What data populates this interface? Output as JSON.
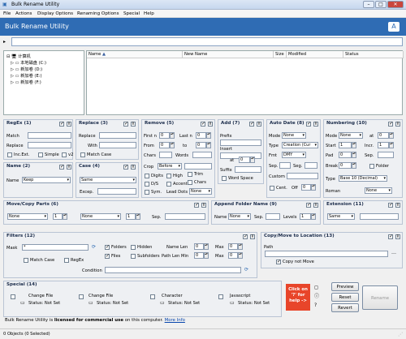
{
  "window": {
    "title": "Bulk Rename Utility",
    "minimize": "–",
    "maximize": "□",
    "close": "✕"
  },
  "menu": [
    "File",
    "Actions",
    "Display Options",
    "Renaming Options",
    "Special",
    "Help"
  ],
  "header": {
    "title": "Bulk Rename Utility"
  },
  "tree": {
    "root": "计算机",
    "items": [
      "本地磁盘 (C:)",
      "新加卷 (D:)",
      "新加卷 (E:)",
      "新加卷 (F:)"
    ]
  },
  "filelist": {
    "columns": [
      "Name",
      "New Name",
      "Size",
      "Modified",
      "Status"
    ]
  },
  "regex": {
    "title": "RegEx (1)",
    "match": "Match",
    "replace": "Replace",
    "incext": "Inc.Ext.",
    "simple": "Simple",
    "v2": "v2"
  },
  "replace": {
    "title": "Replace (3)",
    "replace": "Replace",
    "with": "With",
    "matchcase": "Match Case"
  },
  "remove": {
    "title": "Remove (5)",
    "firstn": "First n",
    "lastn": "Last n",
    "from": "From",
    "to": "to",
    "chars": "Chars",
    "words": "Words",
    "crop": "Crop",
    "crop_val": "Before",
    "digits": "Digits",
    "high": "High",
    "trim": "Trim",
    "ds": "D/S",
    "accents": "Accents",
    "chars2": "Chars",
    "sym": "Sym.",
    "leaddots": "Lead Dots",
    "leaddots_val": "None",
    "firstn_val": "0",
    "lastn_val": "0",
    "from_val": "0",
    "to_val": "0"
  },
  "add": {
    "title": "Add (7)",
    "prefix": "Prefix",
    "insert": "Insert",
    "at": "at",
    "at_val": "0",
    "suffix": "Suffix",
    "wordspace": "Word Space"
  },
  "autodate": {
    "title": "Auto Date (8)",
    "mode": "Mode",
    "mode_val": "None",
    "type": "Type",
    "type_val": "Creation (Cur",
    "fmt": "Fmt",
    "fmt_val": "DMY",
    "sep": "Sep.",
    "seg": "Seg.",
    "custom": "Custom",
    "cent": "Cent.",
    "off": "Off",
    "off_val": "0"
  },
  "numbering": {
    "title": "Numbering (10)",
    "mode": "Mode",
    "mode_val": "None",
    "at": "at",
    "at_val": "0",
    "start": "Start",
    "start_val": "1",
    "incr": "Incr.",
    "incr_val": "1",
    "pad": "Pad",
    "pad_val": "0",
    "sep": "Sep.",
    "break": "Break",
    "break_val": "0",
    "folder": "Folder",
    "type": "Type",
    "type_val": "Base 10 (Decimal)",
    "roman": "Roman",
    "roman_val": "None"
  },
  "name": {
    "title": "Name (2)",
    "name": "Name",
    "name_val": "Keep"
  },
  "case": {
    "title": "Case (4)",
    "case_val": "Same",
    "excep": "Excep."
  },
  "movecopy": {
    "title": "Move/Copy Parts (6)",
    "sel1": "None",
    "num1": "1",
    "sel2": "None",
    "num2": "1",
    "sep": "Sep."
  },
  "appendfolder": {
    "title": "Append Folder Name (9)",
    "name": "Name",
    "name_val": "None",
    "sep": "Sep.",
    "levels": "Levels",
    "levels_val": "1"
  },
  "extension": {
    "title": "Extension (11)",
    "ext_val": "Same"
  },
  "filters": {
    "title": "Filters (12)",
    "mask": "Mask",
    "mask_val": "*",
    "folders": "Folders",
    "hidden": "Hidden",
    "files": "Files",
    "subfolders": "Subfolders",
    "namelen": "Name Len",
    "pathlen": "Path Len Min",
    "min_val": "0",
    "max": "Max",
    "max_val": "0",
    "matchcase": "Match Case",
    "regex": "RegEx",
    "condition": "Condition"
  },
  "copymove": {
    "title": "Copy/Move to Location (13)",
    "path": "Path",
    "copynotmove": "Copy not Move"
  },
  "special": {
    "title": "Special (14)",
    "items": [
      {
        "label": "Change File",
        "status": "Status: Not Set"
      },
      {
        "label": "Change File",
        "status": "Status: Not Set"
      },
      {
        "label": "Character",
        "status": "Status: Not Set"
      },
      {
        "label": "Javascript",
        "status": "Status: Not Set"
      }
    ]
  },
  "help": {
    "line1": "Click on",
    "line2": "'?' for",
    "line3": "help ->"
  },
  "actions": {
    "preview": "Preview",
    "reset": "Reset",
    "revert": "Revert",
    "rename": "Rename"
  },
  "license": {
    "prefix": "Bulk Rename Utility is ",
    "bold": "licensed for commercial use",
    "suffix": " on this computer. ",
    "link": "More Info"
  },
  "status": {
    "objects": "0 Objects (0 Selected)"
  },
  "colors": {
    "header": "#2f6cb4",
    "help": "#e8452a",
    "link": "#0645ad"
  }
}
